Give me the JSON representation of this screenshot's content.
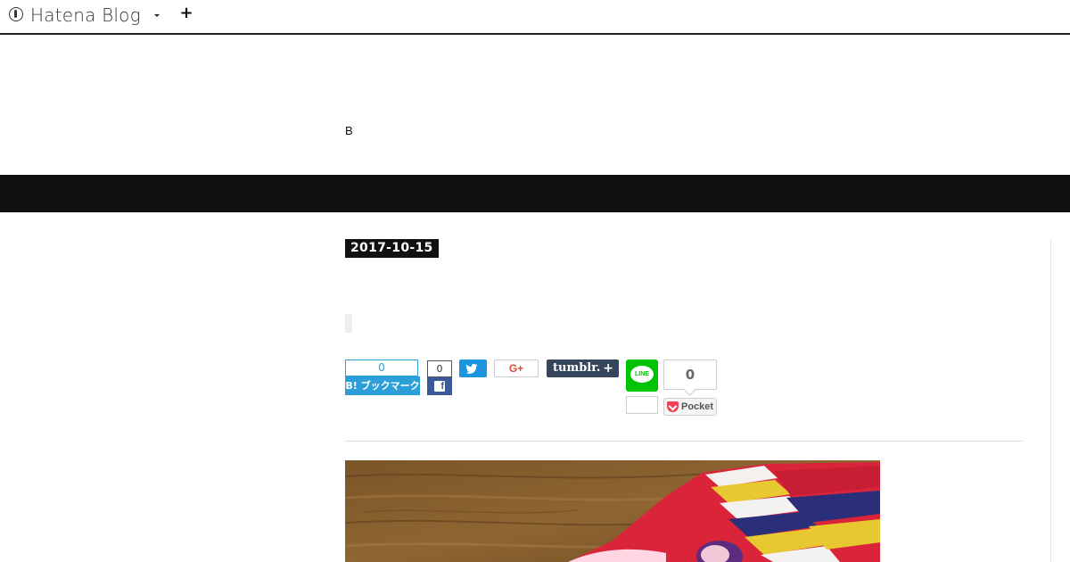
{
  "topbar": {
    "brand": "Hatena Blog",
    "add_symbol": "+"
  },
  "blog": {
    "title": "B"
  },
  "article": {
    "date": "2017-10-15"
  },
  "share": {
    "hatena_count": "0",
    "hatena_label": "B! ブックマーク",
    "facebook_count": "0",
    "facebook_glyph": "f",
    "google_plus_label": "G+",
    "tumblr_label": "tumblr.",
    "tumblr_plus": "+",
    "line_label": "LINE",
    "line_count": "",
    "pocket_count": "0",
    "pocket_label": "Pocket"
  },
  "colors": {
    "hatena": "#2c9ed8",
    "facebook": "#3b5998",
    "twitter": "#1b95e0",
    "google_plus": "#dd4b39",
    "tumblr": "#35465c",
    "line": "#00c300",
    "pocket": "#ef4056",
    "header_band": "#111111"
  }
}
